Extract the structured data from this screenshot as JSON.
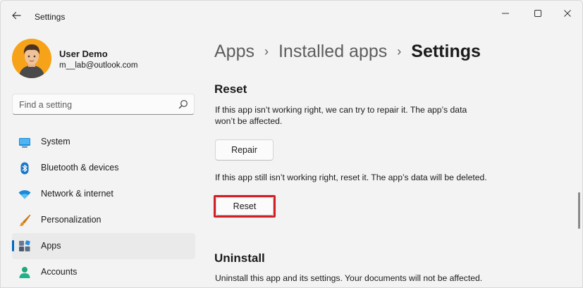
{
  "window": {
    "title": "Settings"
  },
  "profile": {
    "name": "User Demo",
    "email": "m__lab@outlook.com"
  },
  "search": {
    "placeholder": "Find a setting"
  },
  "sidebar": {
    "items": [
      {
        "label": "System",
        "icon": "system-icon"
      },
      {
        "label": "Bluetooth & devices",
        "icon": "bluetooth-icon"
      },
      {
        "label": "Network & internet",
        "icon": "network-icon"
      },
      {
        "label": "Personalization",
        "icon": "brush-icon"
      },
      {
        "label": "Apps",
        "icon": "apps-icon",
        "active": true
      },
      {
        "label": "Accounts",
        "icon": "accounts-icon"
      }
    ]
  },
  "breadcrumb": {
    "items": [
      "Apps",
      "Installed apps"
    ],
    "current": "Settings",
    "separator": "›"
  },
  "reset_section": {
    "title": "Reset",
    "repair_description_line1": "If this app isn’t working right, we can try to repair it. The app’s data",
    "repair_description_line2": "won’t be affected.",
    "repair_button": "Repair",
    "reset_description": "If this app still isn’t working right, reset it. The app’s data will be deleted.",
    "reset_button": "Reset"
  },
  "uninstall_section": {
    "title": "Uninstall",
    "description": "Uninstall this app and its settings. Your documents will not be affected."
  },
  "colors": {
    "accent": "#0067c0",
    "highlight": "#d32027",
    "background": "#f3f3f3"
  }
}
